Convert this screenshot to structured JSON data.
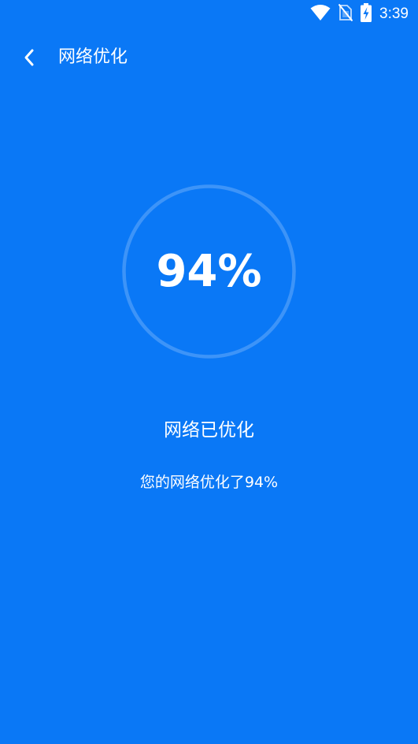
{
  "status_bar": {
    "time": "3:39",
    "icons": [
      "wifi-icon",
      "no-sim-icon",
      "battery-charging-icon"
    ]
  },
  "app_bar": {
    "title": "网络优化",
    "back_icon": "chevron-left-icon"
  },
  "result": {
    "percent": "94%",
    "progress_fraction": 0.94,
    "heading": "网络已优化",
    "detail": "您的网络优化了94%"
  },
  "colors": {
    "background": "#0a78f6",
    "ring": "#3d94f8",
    "text": "#ffffff"
  }
}
